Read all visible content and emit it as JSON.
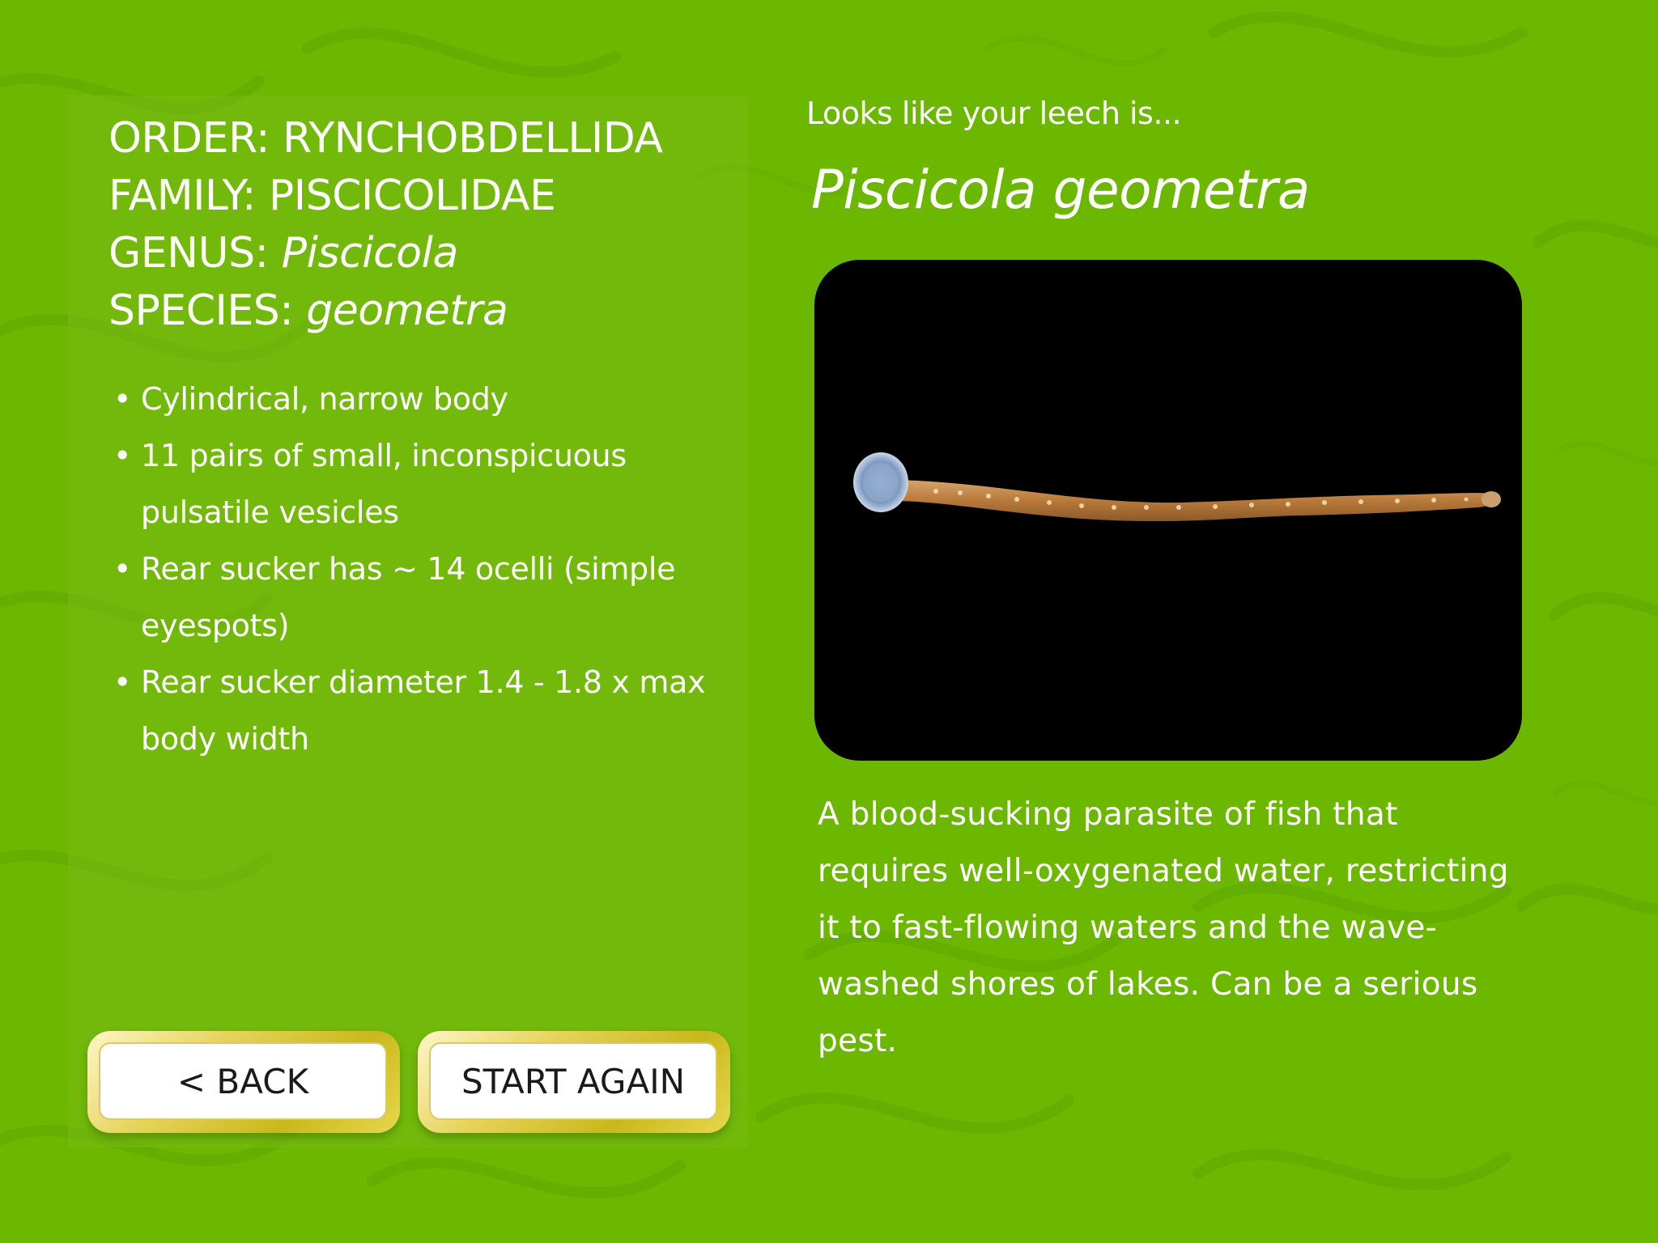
{
  "colors": {
    "background": "#6cb800",
    "panel": "#78b914",
    "button_rim": "#d4c22c",
    "photo_bg": "#000000",
    "text": "#ffffff"
  },
  "taxonomy": {
    "order_label": "ORDER:",
    "order_value": "RYNCHOBDELLIDA",
    "family_label": "FAMILY:",
    "family_value": "PISCICOLIDAE",
    "genus_label": "GENUS:",
    "genus_value": "Piscicola",
    "species_label": "SPECIES:",
    "species_value": "geometra"
  },
  "traits": [
    "Cylindrical, narrow body",
    "11 pairs of small, inconspicuous pulsatile vesicles",
    "Rear sucker has ~ 14 ocelli (simple eyespots)",
    "Rear sucker diameter 1.4 - 1.8 x max body width"
  ],
  "buttons": {
    "back_label": "< BACK",
    "start_again_label": "START AGAIN"
  },
  "result": {
    "lead": "Looks like your leech is...",
    "species_name": "Piscicola geometra",
    "photo_icon": "leech-photo",
    "description": "A blood-sucking parasite of fish that requires well-oxygenated water, restricting it to fast-flowing waters and the wave-washed shores of lakes. Can be a serious pest."
  }
}
